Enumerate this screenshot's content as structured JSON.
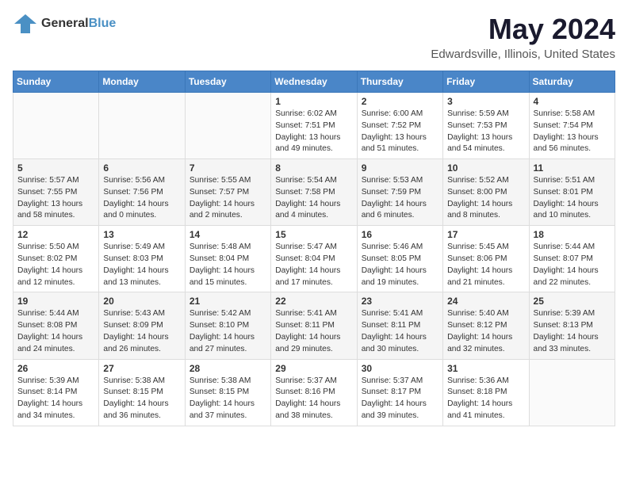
{
  "header": {
    "logo": {
      "text_general": "General",
      "text_blue": "Blue"
    },
    "month": "May 2024",
    "location": "Edwardsville, Illinois, United States"
  },
  "weekdays": [
    "Sunday",
    "Monday",
    "Tuesday",
    "Wednesday",
    "Thursday",
    "Friday",
    "Saturday"
  ],
  "weeks": [
    [
      {
        "day": null
      },
      {
        "day": null
      },
      {
        "day": null
      },
      {
        "day": "1",
        "sunrise": "Sunrise: 6:02 AM",
        "sunset": "Sunset: 7:51 PM",
        "daylight": "Daylight: 13 hours and 49 minutes."
      },
      {
        "day": "2",
        "sunrise": "Sunrise: 6:00 AM",
        "sunset": "Sunset: 7:52 PM",
        "daylight": "Daylight: 13 hours and 51 minutes."
      },
      {
        "day": "3",
        "sunrise": "Sunrise: 5:59 AM",
        "sunset": "Sunset: 7:53 PM",
        "daylight": "Daylight: 13 hours and 54 minutes."
      },
      {
        "day": "4",
        "sunrise": "Sunrise: 5:58 AM",
        "sunset": "Sunset: 7:54 PM",
        "daylight": "Daylight: 13 hours and 56 minutes."
      }
    ],
    [
      {
        "day": "5",
        "sunrise": "Sunrise: 5:57 AM",
        "sunset": "Sunset: 7:55 PM",
        "daylight": "Daylight: 13 hours and 58 minutes."
      },
      {
        "day": "6",
        "sunrise": "Sunrise: 5:56 AM",
        "sunset": "Sunset: 7:56 PM",
        "daylight": "Daylight: 14 hours and 0 minutes."
      },
      {
        "day": "7",
        "sunrise": "Sunrise: 5:55 AM",
        "sunset": "Sunset: 7:57 PM",
        "daylight": "Daylight: 14 hours and 2 minutes."
      },
      {
        "day": "8",
        "sunrise": "Sunrise: 5:54 AM",
        "sunset": "Sunset: 7:58 PM",
        "daylight": "Daylight: 14 hours and 4 minutes."
      },
      {
        "day": "9",
        "sunrise": "Sunrise: 5:53 AM",
        "sunset": "Sunset: 7:59 PM",
        "daylight": "Daylight: 14 hours and 6 minutes."
      },
      {
        "day": "10",
        "sunrise": "Sunrise: 5:52 AM",
        "sunset": "Sunset: 8:00 PM",
        "daylight": "Daylight: 14 hours and 8 minutes."
      },
      {
        "day": "11",
        "sunrise": "Sunrise: 5:51 AM",
        "sunset": "Sunset: 8:01 PM",
        "daylight": "Daylight: 14 hours and 10 minutes."
      }
    ],
    [
      {
        "day": "12",
        "sunrise": "Sunrise: 5:50 AM",
        "sunset": "Sunset: 8:02 PM",
        "daylight": "Daylight: 14 hours and 12 minutes."
      },
      {
        "day": "13",
        "sunrise": "Sunrise: 5:49 AM",
        "sunset": "Sunset: 8:03 PM",
        "daylight": "Daylight: 14 hours and 13 minutes."
      },
      {
        "day": "14",
        "sunrise": "Sunrise: 5:48 AM",
        "sunset": "Sunset: 8:04 PM",
        "daylight": "Daylight: 14 hours and 15 minutes."
      },
      {
        "day": "15",
        "sunrise": "Sunrise: 5:47 AM",
        "sunset": "Sunset: 8:04 PM",
        "daylight": "Daylight: 14 hours and 17 minutes."
      },
      {
        "day": "16",
        "sunrise": "Sunrise: 5:46 AM",
        "sunset": "Sunset: 8:05 PM",
        "daylight": "Daylight: 14 hours and 19 minutes."
      },
      {
        "day": "17",
        "sunrise": "Sunrise: 5:45 AM",
        "sunset": "Sunset: 8:06 PM",
        "daylight": "Daylight: 14 hours and 21 minutes."
      },
      {
        "day": "18",
        "sunrise": "Sunrise: 5:44 AM",
        "sunset": "Sunset: 8:07 PM",
        "daylight": "Daylight: 14 hours and 22 minutes."
      }
    ],
    [
      {
        "day": "19",
        "sunrise": "Sunrise: 5:44 AM",
        "sunset": "Sunset: 8:08 PM",
        "daylight": "Daylight: 14 hours and 24 minutes."
      },
      {
        "day": "20",
        "sunrise": "Sunrise: 5:43 AM",
        "sunset": "Sunset: 8:09 PM",
        "daylight": "Daylight: 14 hours and 26 minutes."
      },
      {
        "day": "21",
        "sunrise": "Sunrise: 5:42 AM",
        "sunset": "Sunset: 8:10 PM",
        "daylight": "Daylight: 14 hours and 27 minutes."
      },
      {
        "day": "22",
        "sunrise": "Sunrise: 5:41 AM",
        "sunset": "Sunset: 8:11 PM",
        "daylight": "Daylight: 14 hours and 29 minutes."
      },
      {
        "day": "23",
        "sunrise": "Sunrise: 5:41 AM",
        "sunset": "Sunset: 8:11 PM",
        "daylight": "Daylight: 14 hours and 30 minutes."
      },
      {
        "day": "24",
        "sunrise": "Sunrise: 5:40 AM",
        "sunset": "Sunset: 8:12 PM",
        "daylight": "Daylight: 14 hours and 32 minutes."
      },
      {
        "day": "25",
        "sunrise": "Sunrise: 5:39 AM",
        "sunset": "Sunset: 8:13 PM",
        "daylight": "Daylight: 14 hours and 33 minutes."
      }
    ],
    [
      {
        "day": "26",
        "sunrise": "Sunrise: 5:39 AM",
        "sunset": "Sunset: 8:14 PM",
        "daylight": "Daylight: 14 hours and 34 minutes."
      },
      {
        "day": "27",
        "sunrise": "Sunrise: 5:38 AM",
        "sunset": "Sunset: 8:15 PM",
        "daylight": "Daylight: 14 hours and 36 minutes."
      },
      {
        "day": "28",
        "sunrise": "Sunrise: 5:38 AM",
        "sunset": "Sunset: 8:15 PM",
        "daylight": "Daylight: 14 hours and 37 minutes."
      },
      {
        "day": "29",
        "sunrise": "Sunrise: 5:37 AM",
        "sunset": "Sunset: 8:16 PM",
        "daylight": "Daylight: 14 hours and 38 minutes."
      },
      {
        "day": "30",
        "sunrise": "Sunrise: 5:37 AM",
        "sunset": "Sunset: 8:17 PM",
        "daylight": "Daylight: 14 hours and 39 minutes."
      },
      {
        "day": "31",
        "sunrise": "Sunrise: 5:36 AM",
        "sunset": "Sunset: 8:18 PM",
        "daylight": "Daylight: 14 hours and 41 minutes."
      },
      {
        "day": null
      }
    ]
  ]
}
